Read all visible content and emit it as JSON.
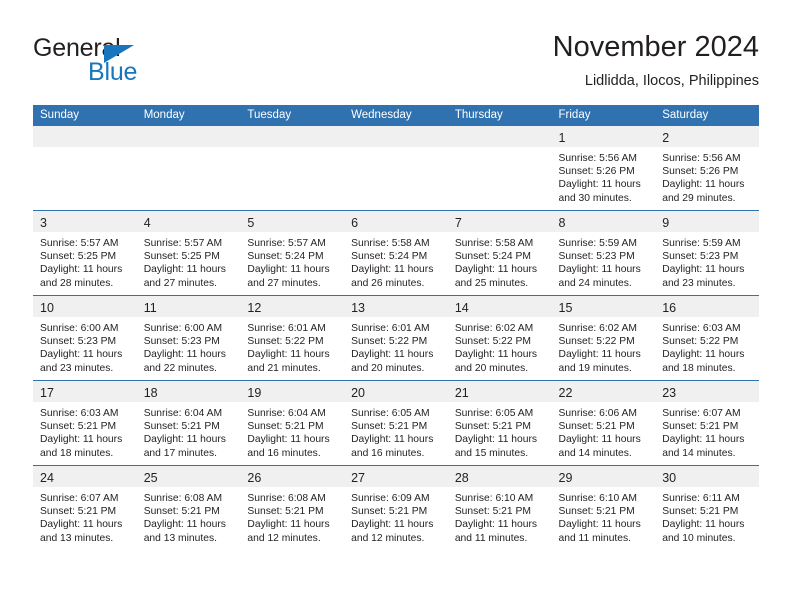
{
  "brand": {
    "word_general": "General",
    "word_blue": "Blue",
    "accent_color": "#1a76bc"
  },
  "header": {
    "title": "November 2024",
    "subtitle": "Lidlidda, Ilocos, Philippines"
  },
  "calendar": {
    "header_bg": "#3071b0",
    "daynum_band_bg": "#f0f0f0",
    "weekday_headers": [
      "Sunday",
      "Monday",
      "Tuesday",
      "Wednesday",
      "Thursday",
      "Friday",
      "Saturday"
    ],
    "weeks": [
      [
        {
          "day": "",
          "empty": true,
          "sunrise": "",
          "sunset": "",
          "daylight1": "",
          "daylight2": ""
        },
        {
          "day": "",
          "empty": true,
          "sunrise": "",
          "sunset": "",
          "daylight1": "",
          "daylight2": ""
        },
        {
          "day": "",
          "empty": true,
          "sunrise": "",
          "sunset": "",
          "daylight1": "",
          "daylight2": ""
        },
        {
          "day": "",
          "empty": true,
          "sunrise": "",
          "sunset": "",
          "daylight1": "",
          "daylight2": ""
        },
        {
          "day": "",
          "empty": true,
          "sunrise": "",
          "sunset": "",
          "daylight1": "",
          "daylight2": ""
        },
        {
          "day": "1",
          "sunrise": "Sunrise: 5:56 AM",
          "sunset": "Sunset: 5:26 PM",
          "daylight1": "Daylight: 11 hours",
          "daylight2": "and 30 minutes."
        },
        {
          "day": "2",
          "sunrise": "Sunrise: 5:56 AM",
          "sunset": "Sunset: 5:26 PM",
          "daylight1": "Daylight: 11 hours",
          "daylight2": "and 29 minutes."
        }
      ],
      [
        {
          "day": "3",
          "sunrise": "Sunrise: 5:57 AM",
          "sunset": "Sunset: 5:25 PM",
          "daylight1": "Daylight: 11 hours",
          "daylight2": "and 28 minutes."
        },
        {
          "day": "4",
          "sunrise": "Sunrise: 5:57 AM",
          "sunset": "Sunset: 5:25 PM",
          "daylight1": "Daylight: 11 hours",
          "daylight2": "and 27 minutes."
        },
        {
          "day": "5",
          "sunrise": "Sunrise: 5:57 AM",
          "sunset": "Sunset: 5:24 PM",
          "daylight1": "Daylight: 11 hours",
          "daylight2": "and 27 minutes."
        },
        {
          "day": "6",
          "sunrise": "Sunrise: 5:58 AM",
          "sunset": "Sunset: 5:24 PM",
          "daylight1": "Daylight: 11 hours",
          "daylight2": "and 26 minutes."
        },
        {
          "day": "7",
          "sunrise": "Sunrise: 5:58 AM",
          "sunset": "Sunset: 5:24 PM",
          "daylight1": "Daylight: 11 hours",
          "daylight2": "and 25 minutes."
        },
        {
          "day": "8",
          "sunrise": "Sunrise: 5:59 AM",
          "sunset": "Sunset: 5:23 PM",
          "daylight1": "Daylight: 11 hours",
          "daylight2": "and 24 minutes."
        },
        {
          "day": "9",
          "sunrise": "Sunrise: 5:59 AM",
          "sunset": "Sunset: 5:23 PM",
          "daylight1": "Daylight: 11 hours",
          "daylight2": "and 23 minutes."
        }
      ],
      [
        {
          "day": "10",
          "sunrise": "Sunrise: 6:00 AM",
          "sunset": "Sunset: 5:23 PM",
          "daylight1": "Daylight: 11 hours",
          "daylight2": "and 23 minutes."
        },
        {
          "day": "11",
          "sunrise": "Sunrise: 6:00 AM",
          "sunset": "Sunset: 5:23 PM",
          "daylight1": "Daylight: 11 hours",
          "daylight2": "and 22 minutes."
        },
        {
          "day": "12",
          "sunrise": "Sunrise: 6:01 AM",
          "sunset": "Sunset: 5:22 PM",
          "daylight1": "Daylight: 11 hours",
          "daylight2": "and 21 minutes."
        },
        {
          "day": "13",
          "sunrise": "Sunrise: 6:01 AM",
          "sunset": "Sunset: 5:22 PM",
          "daylight1": "Daylight: 11 hours",
          "daylight2": "and 20 minutes."
        },
        {
          "day": "14",
          "sunrise": "Sunrise: 6:02 AM",
          "sunset": "Sunset: 5:22 PM",
          "daylight1": "Daylight: 11 hours",
          "daylight2": "and 20 minutes."
        },
        {
          "day": "15",
          "sunrise": "Sunrise: 6:02 AM",
          "sunset": "Sunset: 5:22 PM",
          "daylight1": "Daylight: 11 hours",
          "daylight2": "and 19 minutes."
        },
        {
          "day": "16",
          "sunrise": "Sunrise: 6:03 AM",
          "sunset": "Sunset: 5:22 PM",
          "daylight1": "Daylight: 11 hours",
          "daylight2": "and 18 minutes."
        }
      ],
      [
        {
          "day": "17",
          "sunrise": "Sunrise: 6:03 AM",
          "sunset": "Sunset: 5:21 PM",
          "daylight1": "Daylight: 11 hours",
          "daylight2": "and 18 minutes."
        },
        {
          "day": "18",
          "sunrise": "Sunrise: 6:04 AM",
          "sunset": "Sunset: 5:21 PM",
          "daylight1": "Daylight: 11 hours",
          "daylight2": "and 17 minutes."
        },
        {
          "day": "19",
          "sunrise": "Sunrise: 6:04 AM",
          "sunset": "Sunset: 5:21 PM",
          "daylight1": "Daylight: 11 hours",
          "daylight2": "and 16 minutes."
        },
        {
          "day": "20",
          "sunrise": "Sunrise: 6:05 AM",
          "sunset": "Sunset: 5:21 PM",
          "daylight1": "Daylight: 11 hours",
          "daylight2": "and 16 minutes."
        },
        {
          "day": "21",
          "sunrise": "Sunrise: 6:05 AM",
          "sunset": "Sunset: 5:21 PM",
          "daylight1": "Daylight: 11 hours",
          "daylight2": "and 15 minutes."
        },
        {
          "day": "22",
          "sunrise": "Sunrise: 6:06 AM",
          "sunset": "Sunset: 5:21 PM",
          "daylight1": "Daylight: 11 hours",
          "daylight2": "and 14 minutes."
        },
        {
          "day": "23",
          "sunrise": "Sunrise: 6:07 AM",
          "sunset": "Sunset: 5:21 PM",
          "daylight1": "Daylight: 11 hours",
          "daylight2": "and 14 minutes."
        }
      ],
      [
        {
          "day": "24",
          "sunrise": "Sunrise: 6:07 AM",
          "sunset": "Sunset: 5:21 PM",
          "daylight1": "Daylight: 11 hours",
          "daylight2": "and 13 minutes."
        },
        {
          "day": "25",
          "sunrise": "Sunrise: 6:08 AM",
          "sunset": "Sunset: 5:21 PM",
          "daylight1": "Daylight: 11 hours",
          "daylight2": "and 13 minutes."
        },
        {
          "day": "26",
          "sunrise": "Sunrise: 6:08 AM",
          "sunset": "Sunset: 5:21 PM",
          "daylight1": "Daylight: 11 hours",
          "daylight2": "and 12 minutes."
        },
        {
          "day": "27",
          "sunrise": "Sunrise: 6:09 AM",
          "sunset": "Sunset: 5:21 PM",
          "daylight1": "Daylight: 11 hours",
          "daylight2": "and 12 minutes."
        },
        {
          "day": "28",
          "sunrise": "Sunrise: 6:10 AM",
          "sunset": "Sunset: 5:21 PM",
          "daylight1": "Daylight: 11 hours",
          "daylight2": "and 11 minutes."
        },
        {
          "day": "29",
          "sunrise": "Sunrise: 6:10 AM",
          "sunset": "Sunset: 5:21 PM",
          "daylight1": "Daylight: 11 hours",
          "daylight2": "and 11 minutes."
        },
        {
          "day": "30",
          "sunrise": "Sunrise: 6:11 AM",
          "sunset": "Sunset: 5:21 PM",
          "daylight1": "Daylight: 11 hours",
          "daylight2": "and 10 minutes."
        }
      ]
    ]
  }
}
